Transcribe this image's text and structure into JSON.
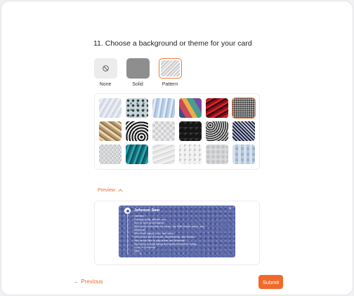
{
  "question": {
    "number": "11.",
    "text": "Choose a background or theme for your card",
    "full": "11. Choose a background or theme for your card"
  },
  "background_types": [
    {
      "label": "None",
      "icon": "no-background-icon",
      "selected": false
    },
    {
      "label": "Solid",
      "color": "#8e8e8e",
      "selected": false
    },
    {
      "label": "Pattern",
      "selected": true
    }
  ],
  "patterns": [
    {
      "name": "soft-waves-light",
      "selected": false
    },
    {
      "name": "dark-dots-teal",
      "selected": false
    },
    {
      "name": "blue-light-stripes",
      "selected": false
    },
    {
      "name": "colorful-triangles",
      "selected": false
    },
    {
      "name": "red-black-waves",
      "selected": false
    },
    {
      "name": "black-white-dots",
      "selected": true
    },
    {
      "name": "gold-folds",
      "selected": false
    },
    {
      "name": "bw-spiral",
      "selected": false
    },
    {
      "name": "white-cubes",
      "selected": false
    },
    {
      "name": "black-geometric",
      "selected": false
    },
    {
      "name": "bw-curves",
      "selected": false
    },
    {
      "name": "navy-chevrons",
      "selected": false
    },
    {
      "name": "grey-diamonds",
      "selected": false
    },
    {
      "name": "teal-waves",
      "selected": false
    },
    {
      "name": "white-zigzag",
      "selected": false
    },
    {
      "name": "white-3d-squares",
      "selected": false
    },
    {
      "name": "grey-hexagons",
      "selected": false
    },
    {
      "name": "blue-rectangles",
      "selected": false
    }
  ],
  "preview": {
    "toggle_label": "Preview",
    "name": "Johnson Sam",
    "lines": [
      "Johnson",
      "Friendly, witty, athletic, fun",
      "Son of John and Miranda",
      "Who loves chocolate ice cream, the Wild Kratts, trains, and",
      "Minecraft",
      "Who feels happy, tired, and lucky",
      "Who is/is a kid of a team, thunderbolts, and Scouts",
      "Who would like to play trains and Minecraft",
      "Who likes to build things and draw his favorite things",
      "Lives in Somerset",
      "Sam"
    ],
    "close_icon": "close-icon",
    "background_color": "#5a67a8"
  },
  "nav": {
    "previous_label": "← Previous",
    "submit_label": "Submit",
    "accent": "#f06a2c"
  }
}
